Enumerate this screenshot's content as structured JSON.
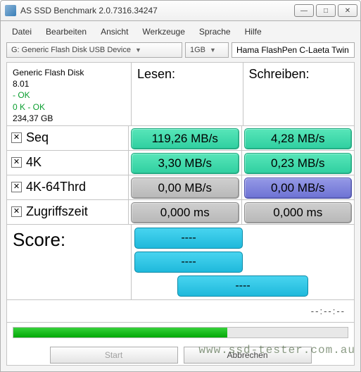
{
  "window": {
    "title": "AS SSD Benchmark 2.0.7316.34247"
  },
  "menu": {
    "datei": "Datei",
    "bearbeiten": "Bearbeiten",
    "ansicht": "Ansicht",
    "werkzeuge": "Werkzeuge",
    "sprache": "Sprache",
    "hilfe": "Hilfe"
  },
  "toolbar": {
    "device": "G: Generic Flash Disk USB Device",
    "size": "1GB",
    "name": "Hama FlashPen C-Laeta Twin"
  },
  "info": {
    "model": "Generic Flash Disk",
    "fw": "8.01",
    "ok1": " - OK",
    "ok2": "0 K - OK",
    "cap": "234,37 GB"
  },
  "headers": {
    "read": "Lesen:",
    "write": "Schreiben:"
  },
  "rows": {
    "seq": {
      "label": "Seq",
      "checked": true,
      "read": "119,26 MB/s",
      "rclass": "c-green",
      "write": "4,28 MB/s",
      "wclass": "c-green"
    },
    "k4": {
      "label": "4K",
      "checked": true,
      "read": "3,30 MB/s",
      "rclass": "c-green",
      "write": "0,23 MB/s",
      "wclass": "c-green"
    },
    "k4t": {
      "label": "4K-64Thrd",
      "checked": true,
      "read": "0,00 MB/s",
      "rclass": "c-gray",
      "write": "0,00 MB/s",
      "wclass": "c-blue"
    },
    "acc": {
      "label": "Zugriffszeit",
      "checked": true,
      "read": "0,000 ms",
      "rclass": "c-gray",
      "write": "0,000 ms",
      "wclass": "c-gray"
    }
  },
  "score": {
    "label": "Score:",
    "s1": "----",
    "s2": "----",
    "s3": "----"
  },
  "trail": "--:--:--",
  "progress_pct": 64,
  "buttons": {
    "start": "Start",
    "abbrechen": "Abbrechen"
  },
  "watermark": "www.ssd-tester.com.au",
  "chart_data": {
    "type": "table",
    "title": "AS SSD Benchmark",
    "rows": [
      {
        "test": "Seq",
        "read_MBps": 119.26,
        "write_MBps": 4.28
      },
      {
        "test": "4K",
        "read_MBps": 3.3,
        "write_MBps": 0.23
      },
      {
        "test": "4K-64Thrd",
        "read_MBps": 0.0,
        "write_MBps": 0.0
      },
      {
        "test": "Zugriffszeit",
        "read_ms": 0.0,
        "write_ms": 0.0
      }
    ],
    "score": {
      "read": null,
      "write": null,
      "total": null
    }
  }
}
